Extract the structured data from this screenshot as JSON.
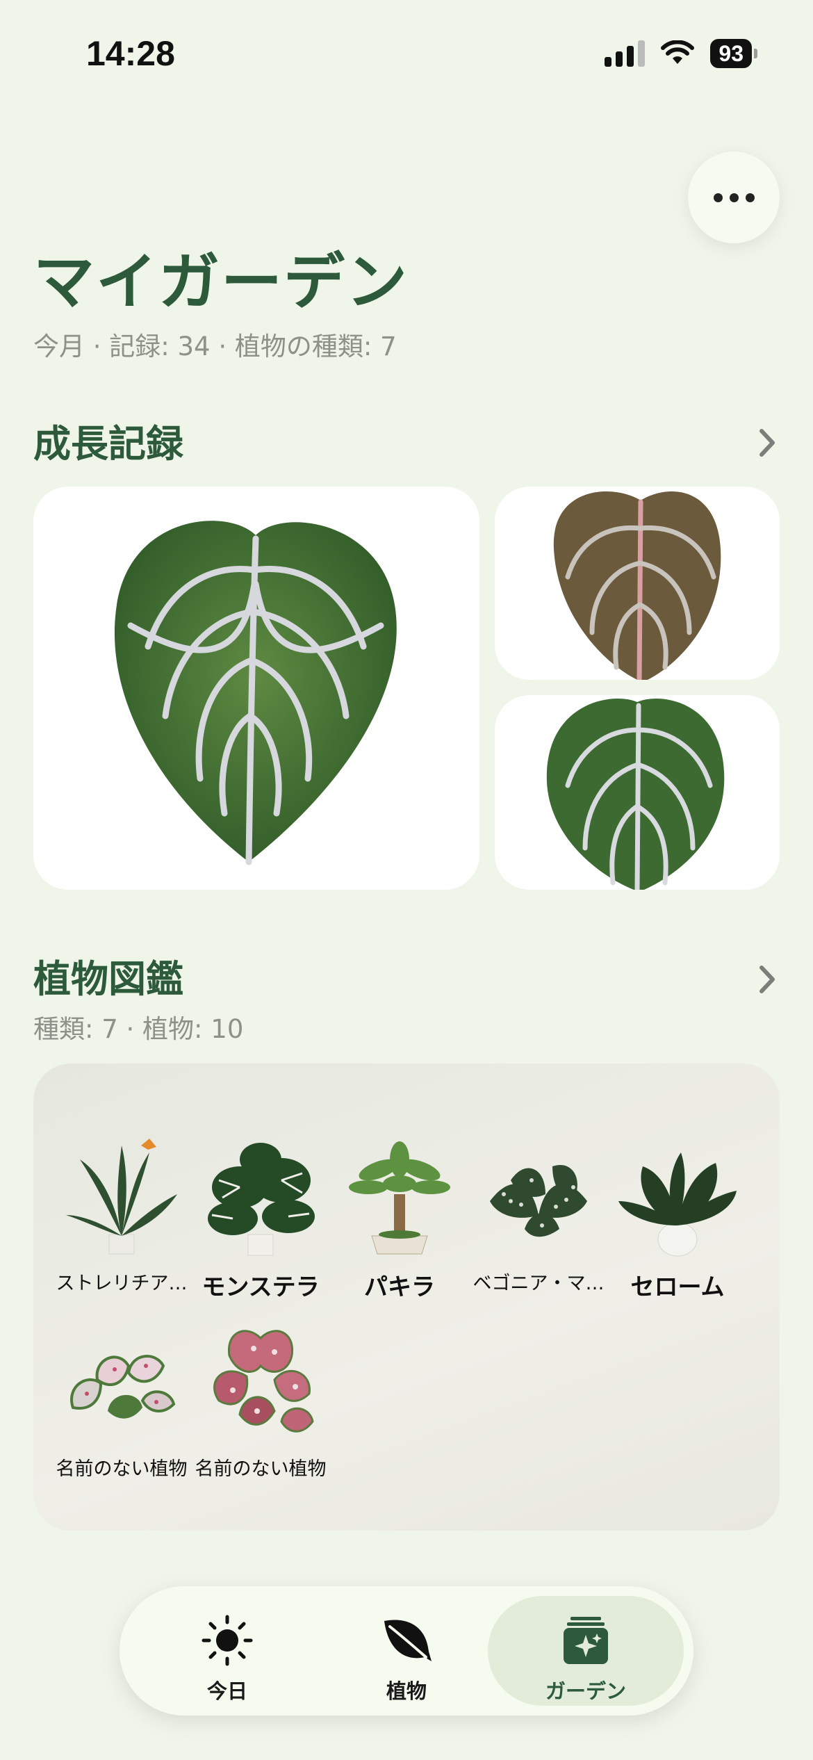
{
  "status_bar": {
    "time": "14:28",
    "battery": "93"
  },
  "header": {
    "title": "マイガーデン",
    "subtitle": "今月 · 記録: 34 · 植物の種類: 7"
  },
  "growth": {
    "title": "成長記録"
  },
  "encyclopedia": {
    "title": "植物図鑑",
    "subtitle": "種類: 7 · 植物: 10",
    "plants": [
      {
        "name": "ストレリチア…"
      },
      {
        "name": "モンステラ"
      },
      {
        "name": "パキラ"
      },
      {
        "name": "ベゴニア・マ…"
      },
      {
        "name": "セローム"
      },
      {
        "name": "名前のない植物"
      },
      {
        "name": "名前のない植物"
      }
    ]
  },
  "tabs": [
    {
      "label": "今日",
      "icon": "sun-icon",
      "active": false
    },
    {
      "label": "植物",
      "icon": "leaf-icon",
      "active": false
    },
    {
      "label": "ガーデン",
      "icon": "garden-icon",
      "active": true
    }
  ],
  "colors": {
    "accent": "#2c5a3a",
    "background": "#eff5e8",
    "muted": "#8d918a"
  }
}
